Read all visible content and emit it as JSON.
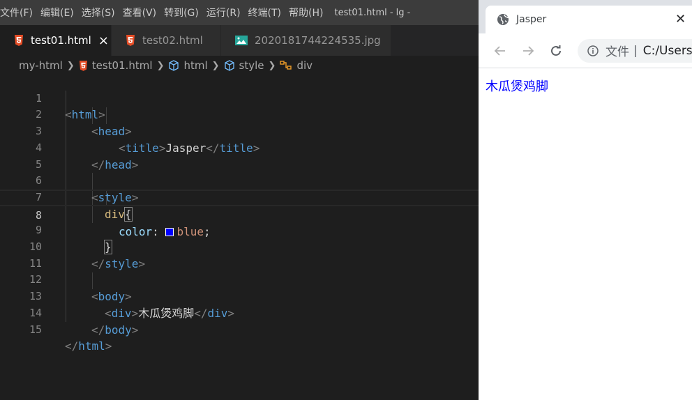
{
  "menubar": {
    "items": [
      "文件(F)",
      "编辑(E)",
      "选择(S)",
      "查看(V)",
      "转到(G)",
      "运行(R)",
      "终端(T)",
      "帮助(H)"
    ],
    "window_title": "test01.html - lg -"
  },
  "tabs": [
    {
      "label": "test01.html",
      "icon": "html5-icon",
      "active": true
    },
    {
      "label": "test02.html",
      "icon": "html5-icon",
      "active": false
    },
    {
      "label": "2020181744224535.jpg",
      "icon": "image-icon",
      "active": false
    }
  ],
  "breadcrumb": {
    "folder": "my-html",
    "file": "test01.html",
    "sym1": "html",
    "sym2": "style",
    "sym3": "div"
  },
  "editor": {
    "current_line": 8,
    "line_numbers": [
      "1",
      "2",
      "3",
      "4",
      "5",
      "6",
      "7",
      "8",
      "9",
      "10",
      "11",
      "12",
      "13",
      "14",
      "15"
    ],
    "tokens": {
      "l1_open": "<",
      "l1_tag": "html",
      "l1_close": ">",
      "l2_open": "<",
      "l2_tag": "head",
      "l2_close": ">",
      "l3_open": "<",
      "l3_tag": "title",
      "l3_close": ">",
      "l3_text": "Jasper",
      "l3_open2": "</",
      "l3_tag2": "title",
      "l3_close2": ">",
      "l4_open": "</",
      "l4_tag": "head",
      "l4_close": ">",
      "l6_open": "<",
      "l6_tag": "style",
      "l6_close": ">",
      "l7_sel": "div",
      "l7_brace": "{",
      "l8_prop": "color",
      "l8_colon": ": ",
      "l8_val": "blue",
      "l8_semi": ";",
      "l9_brace": "}",
      "l10_open": "</",
      "l10_tag": "style",
      "l10_close": ">",
      "l12_open": "<",
      "l12_tag": "body",
      "l12_close": ">",
      "l13_open": "<",
      "l13_tag": "div",
      "l13_close": ">",
      "l13_text": "木瓜煲鸡脚",
      "l13_open2": "</",
      "l13_tag2": "div",
      "l13_close2": ">",
      "l14_open": "</",
      "l14_tag": "body",
      "l14_close": ">",
      "l15_open": "</",
      "l15_tag": "html",
      "l15_close": ">"
    },
    "swatch_color": "#0000ff"
  },
  "browser": {
    "tab_title": "Jasper",
    "address_label": "文件",
    "address_sep": "|",
    "url": "C:/Users/",
    "page_text": "木瓜煲鸡脚",
    "page_text_color": "#0000ff"
  }
}
